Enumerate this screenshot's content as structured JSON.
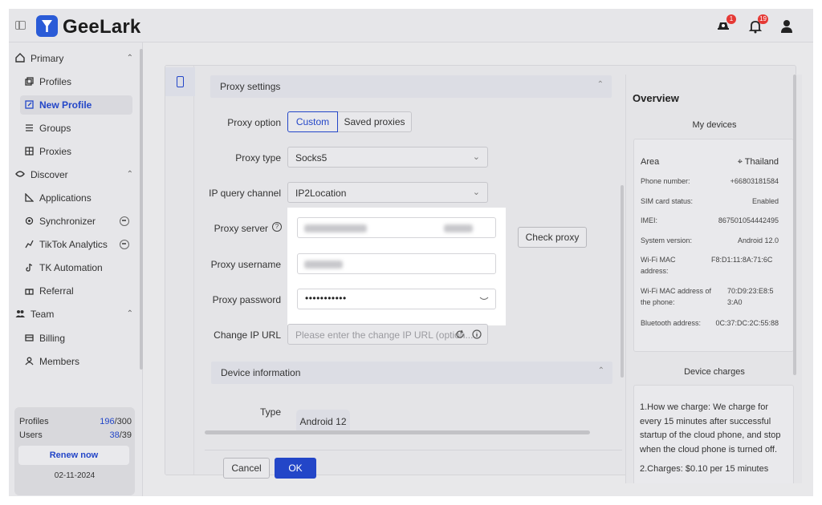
{
  "app": {
    "title": "GeeLark"
  },
  "header": {
    "notifications_badge_1": "1",
    "notifications_badge_2": "19"
  },
  "sidebar": {
    "groups": [
      {
        "label": "Primary",
        "items": [
          "Profiles",
          "New Profile",
          "Groups",
          "Proxies"
        ]
      },
      {
        "label": "Discover",
        "items": [
          "Applications",
          "Synchronizer",
          "TikTok Analytics",
          "TK Automation",
          "Referral"
        ]
      },
      {
        "label": "Team",
        "items": [
          "Billing",
          "Members"
        ]
      }
    ],
    "active_item": "New Profile",
    "usage": {
      "profiles_label": "Profiles",
      "profiles_used": "196",
      "profiles_total": "/300",
      "users_label": "Users",
      "users_used": "38",
      "users_total": "/39",
      "renew_label": "Renew now",
      "date": "02-11-2024"
    }
  },
  "form": {
    "proxy_section": "Proxy settings",
    "proxy_option_label": "Proxy option",
    "proxy_option_custom": "Custom",
    "proxy_option_saved": "Saved proxies",
    "proxy_type_label": "Proxy type",
    "proxy_type_value": "Socks5",
    "ip_query_label": "IP query channel",
    "ip_query_value": "IP2Location",
    "proxy_server_label": "Proxy server",
    "proxy_username_label": "Proxy username",
    "proxy_password_label": "Proxy password",
    "proxy_password_value": "•••••••••••",
    "check_proxy_label": "Check proxy",
    "change_ip_label": "Change IP URL",
    "change_ip_placeholder": "Please enter the change IP URL (option...",
    "device_section": "Device information",
    "type_label": "Type",
    "type_value": "Android 12",
    "cancel_label": "Cancel",
    "ok_label": "OK"
  },
  "overview": {
    "title": "Overview",
    "my_devices": "My devices",
    "rows": [
      {
        "k": "Area",
        "v": "Thailand"
      },
      {
        "k": "Phone number:",
        "v": "+66803181584"
      },
      {
        "k": "SIM card status:",
        "v": "Enabled"
      },
      {
        "k": "IMEI:",
        "v": "867501054442495"
      },
      {
        "k": "System version:",
        "v": "Android 12.0"
      },
      {
        "k": "Wi-Fi MAC address:",
        "v": "F8:D1:11:8A:71:6C"
      },
      {
        "k": "Wi-Fi MAC address of the phone:",
        "v": "70:D9:23:E8:53:A0"
      },
      {
        "k": "Bluetooth address:",
        "v": "0C:37:DC:2C:55:88"
      }
    ],
    "charges_title": "Device charges",
    "charges_text_1": "1.How we charge: We charge for every 15 minutes after successful startup of the cloud phone, and stop when the cloud phone is turned off.",
    "charges_text_2": "2.Charges: $0.10 per 15 minutes"
  },
  "colors": {
    "accent": "#2346c8",
    "badge": "#e53935"
  }
}
